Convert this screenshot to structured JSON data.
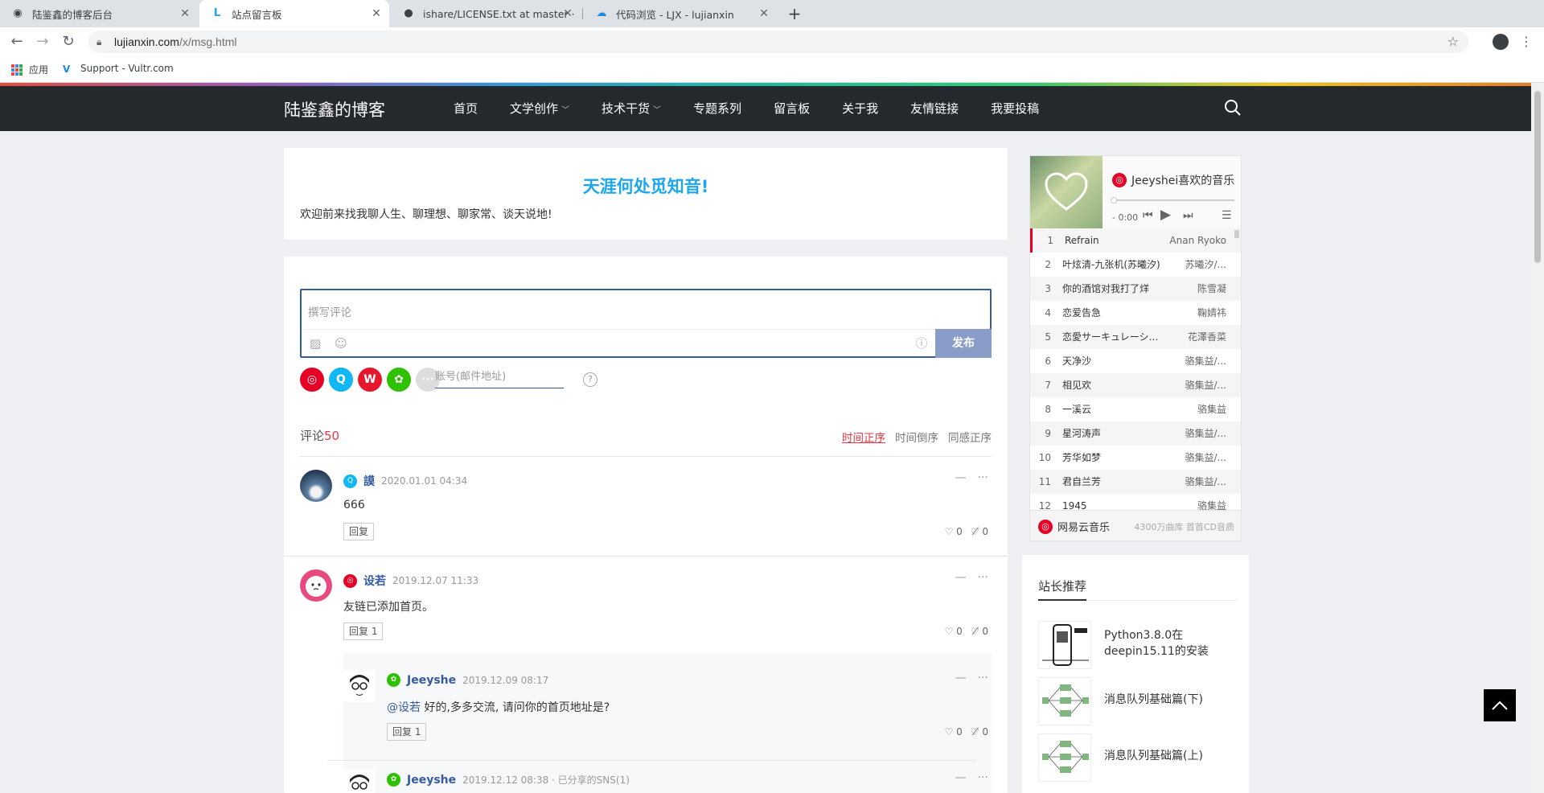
{
  "browser": {
    "tabs": [
      {
        "title": "陆鉴鑫的博客后台",
        "icon": "globe-icon"
      },
      {
        "title": "站点留言板",
        "icon": "site-l-icon"
      },
      {
        "title": "ishare/LICENSE.txt at master · ",
        "icon": "github-icon"
      },
      {
        "title": "代码浏览 - LJX - lujianxin",
        "icon": "cloud-icon"
      }
    ],
    "url_host": "lujianxin.com",
    "url_path": "/x/msg.html",
    "bookmarks": {
      "apps": "应用",
      "vultr": "Support - Vultr.com"
    }
  },
  "site": {
    "logo": "陆鉴鑫的博客",
    "nav": [
      {
        "label": "首页",
        "dropdown": false
      },
      {
        "label": "文学创作",
        "dropdown": true
      },
      {
        "label": "技术干货",
        "dropdown": true
      },
      {
        "label": "专题系列",
        "dropdown": false
      },
      {
        "label": "留言板",
        "dropdown": false
      },
      {
        "label": "关于我",
        "dropdown": false
      },
      {
        "label": "友情链接",
        "dropdown": false
      },
      {
        "label": "我要投稿",
        "dropdown": false
      }
    ]
  },
  "intro": {
    "title": "天涯何处觅知音!",
    "text": "欢迎前来找我聊人生、聊理想、聊家常、谈天说地!"
  },
  "editor": {
    "placeholder": "撰写评论",
    "submit": "发布",
    "account_placeholder": "账号(邮件地址)",
    "help": "?"
  },
  "comments_header": {
    "label": "评论",
    "count": "50",
    "sort": [
      "时间正序",
      "时间倒序",
      "同感正序"
    ]
  },
  "comments": [
    {
      "name": "謨",
      "time": "2020.01.01 04:34",
      "text": "666",
      "reply": "回复",
      "likes": "0",
      "dislikes": "0",
      "source": "qq"
    },
    {
      "name": "设若",
      "time": "2019.12.07 11:33",
      "text": "友链已添加首页。",
      "reply": "回复 1",
      "likes": "0",
      "dislikes": "0",
      "source": "netease"
    },
    {
      "name": "Jeeyshe",
      "time": "2019.12.09 08:17",
      "at": "@设若",
      "text": "好的,多多交流, 请问你的首页地址是?",
      "reply": "回复 1",
      "likes": "0",
      "dislikes": "0",
      "source": "wechat"
    },
    {
      "name": "Jeeyshe",
      "time": "2019.12.12 08:38 · 已分享的SNS(1)",
      "source": "wechat"
    }
  ],
  "player": {
    "title": "Jeeyshei喜欢的音乐",
    "time": "- 0:00",
    "tracks": [
      {
        "no": "1",
        "song": "Refrain",
        "singer": "Anan Ryoko"
      },
      {
        "no": "2",
        "song": "叶炫清-九张机(苏曦汐)",
        "singer": "苏曦汐/..."
      },
      {
        "no": "3",
        "song": "你的酒馆对我打了烊",
        "singer": "陈雪凝"
      },
      {
        "no": "4",
        "song": "恋爱告急",
        "singer": "鞠婧祎"
      },
      {
        "no": "5",
        "song": "恋愛サーキュレーション",
        "singer": "花澤香菜"
      },
      {
        "no": "6",
        "song": "天净沙",
        "singer": "骆集益/..."
      },
      {
        "no": "7",
        "song": "相见欢",
        "singer": "骆集益/..."
      },
      {
        "no": "8",
        "song": "一溪云",
        "singer": "骆集益"
      },
      {
        "no": "9",
        "song": "星河涛声",
        "singer": "骆集益/..."
      },
      {
        "no": "10",
        "song": "芳华如梦",
        "singer": "骆集益/..."
      },
      {
        "no": "11",
        "song": "君自兰芳",
        "singer": "骆集益/..."
      },
      {
        "no": "12",
        "song": "1945",
        "singer": "骆集益"
      }
    ],
    "brand": "网易云音乐",
    "slogan": "4300万曲库 首首CD音质"
  },
  "recommend": {
    "title": "站长推荐",
    "items": [
      {
        "title": "Python3.8.0在deepin15.11的安装"
      },
      {
        "title": "消息队列基础篇(下)"
      },
      {
        "title": "消息队列基础篇(上)"
      }
    ]
  },
  "colors": {
    "accent": "#345ba2",
    "header": "#24292e",
    "highlight": "#1ca7ec",
    "count": "#e63946"
  }
}
